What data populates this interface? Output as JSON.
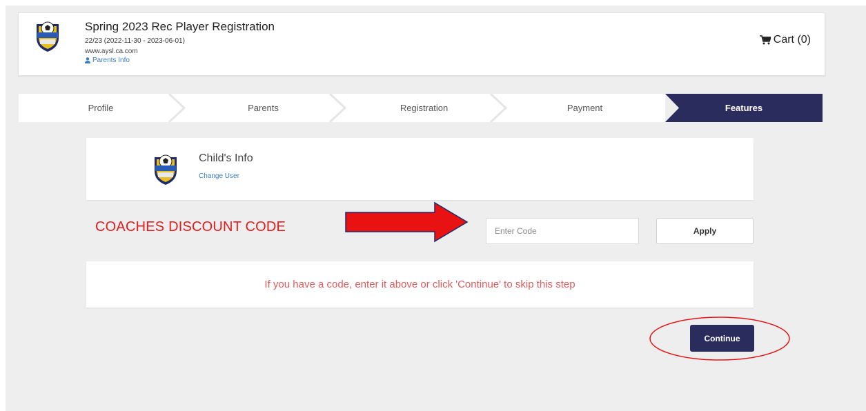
{
  "header": {
    "title": "Spring 2023 Rec Player Registration",
    "season": "22/23 (2022-11-30 - 2023-06-01)",
    "website": "www.aysl.ca.com",
    "parents_info_link": "Parents Info",
    "cart_label": "Cart (0)",
    "logo_icon": "soccer-club-logo"
  },
  "stepper": {
    "steps": [
      "Profile",
      "Parents",
      "Registration",
      "Payment",
      "Features"
    ],
    "active_index": 4,
    "active_color": "#2b2c5e"
  },
  "child": {
    "title": "Child's Info",
    "change_link": "Change User"
  },
  "discount": {
    "annotation": "COACHES DISCOUNT CODE",
    "input_placeholder": "Enter Code",
    "input_value": "",
    "apply_label": "Apply"
  },
  "message": {
    "text": "If you have a code, enter it above or click 'Continue' to skip this step",
    "color": "#e05b5b"
  },
  "actions": {
    "continue_label": "Continue"
  },
  "colors": {
    "primary": "#2b2c5e",
    "link": "#3b7fc4",
    "annotation": "#e21c1c"
  }
}
